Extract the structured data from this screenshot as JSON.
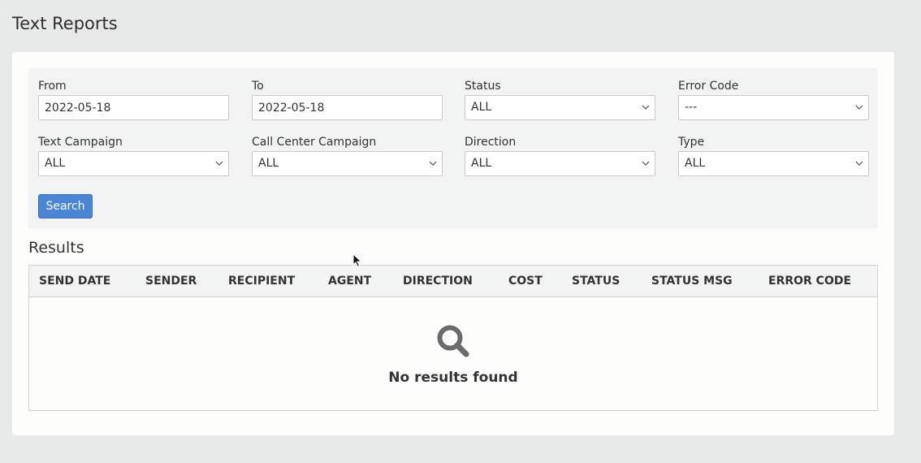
{
  "page": {
    "title": "Text Reports"
  },
  "filters": {
    "from": {
      "label": "From",
      "value": "2022-05-18"
    },
    "to": {
      "label": "To",
      "value": "2022-05-18"
    },
    "status": {
      "label": "Status",
      "value": "ALL"
    },
    "error_code": {
      "label": "Error Code",
      "value": "---"
    },
    "text_campaign": {
      "label": "Text Campaign",
      "value": "ALL"
    },
    "call_center_campaign": {
      "label": "Call Center Campaign",
      "value": "ALL"
    },
    "direction": {
      "label": "Direction",
      "value": "ALL"
    },
    "type": {
      "label": "Type",
      "value": "ALL"
    },
    "search_label": "Search"
  },
  "results": {
    "title": "Results",
    "columns": [
      "SEND DATE",
      "SENDER",
      "RECIPIENT",
      "AGENT",
      "DIRECTION",
      "COST",
      "STATUS",
      "STATUS MSG",
      "ERROR CODE"
    ],
    "empty_message": "No results found",
    "empty_icon": "search-icon"
  },
  "colors": {
    "accent": "#4b86d6",
    "background": "#e8e9e9",
    "panel": "#f2f3f3"
  }
}
